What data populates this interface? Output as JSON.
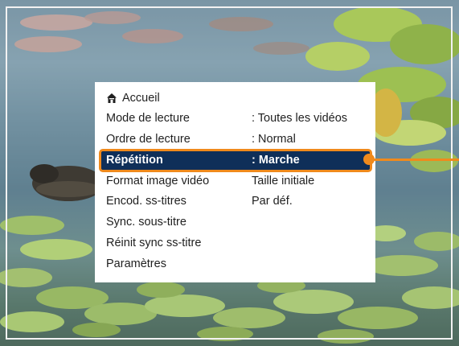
{
  "menu": {
    "home": {
      "icon": "home-icon",
      "label": "Accueil"
    },
    "items": [
      {
        "label": "Mode de lecture",
        "value": ": Toutes les vidéos"
      },
      {
        "label": "Ordre de lecture",
        "value": ": Normal"
      },
      {
        "label": "Répétition",
        "value": ": Marche",
        "selected": true
      },
      {
        "label": "Format image vidéo",
        "value": "Taille initiale"
      },
      {
        "label": "Encod. ss-titres",
        "value": "Par déf."
      },
      {
        "label": "Sync. sous-titre",
        "value": ""
      },
      {
        "label": "Réinit sync ss-titre",
        "value": ""
      },
      {
        "label": "Paramètres",
        "value": ""
      }
    ]
  },
  "colors": {
    "highlight_bg": "#0f2f59",
    "highlight_border": "#f08a1c",
    "callout": "#f08a1c"
  }
}
